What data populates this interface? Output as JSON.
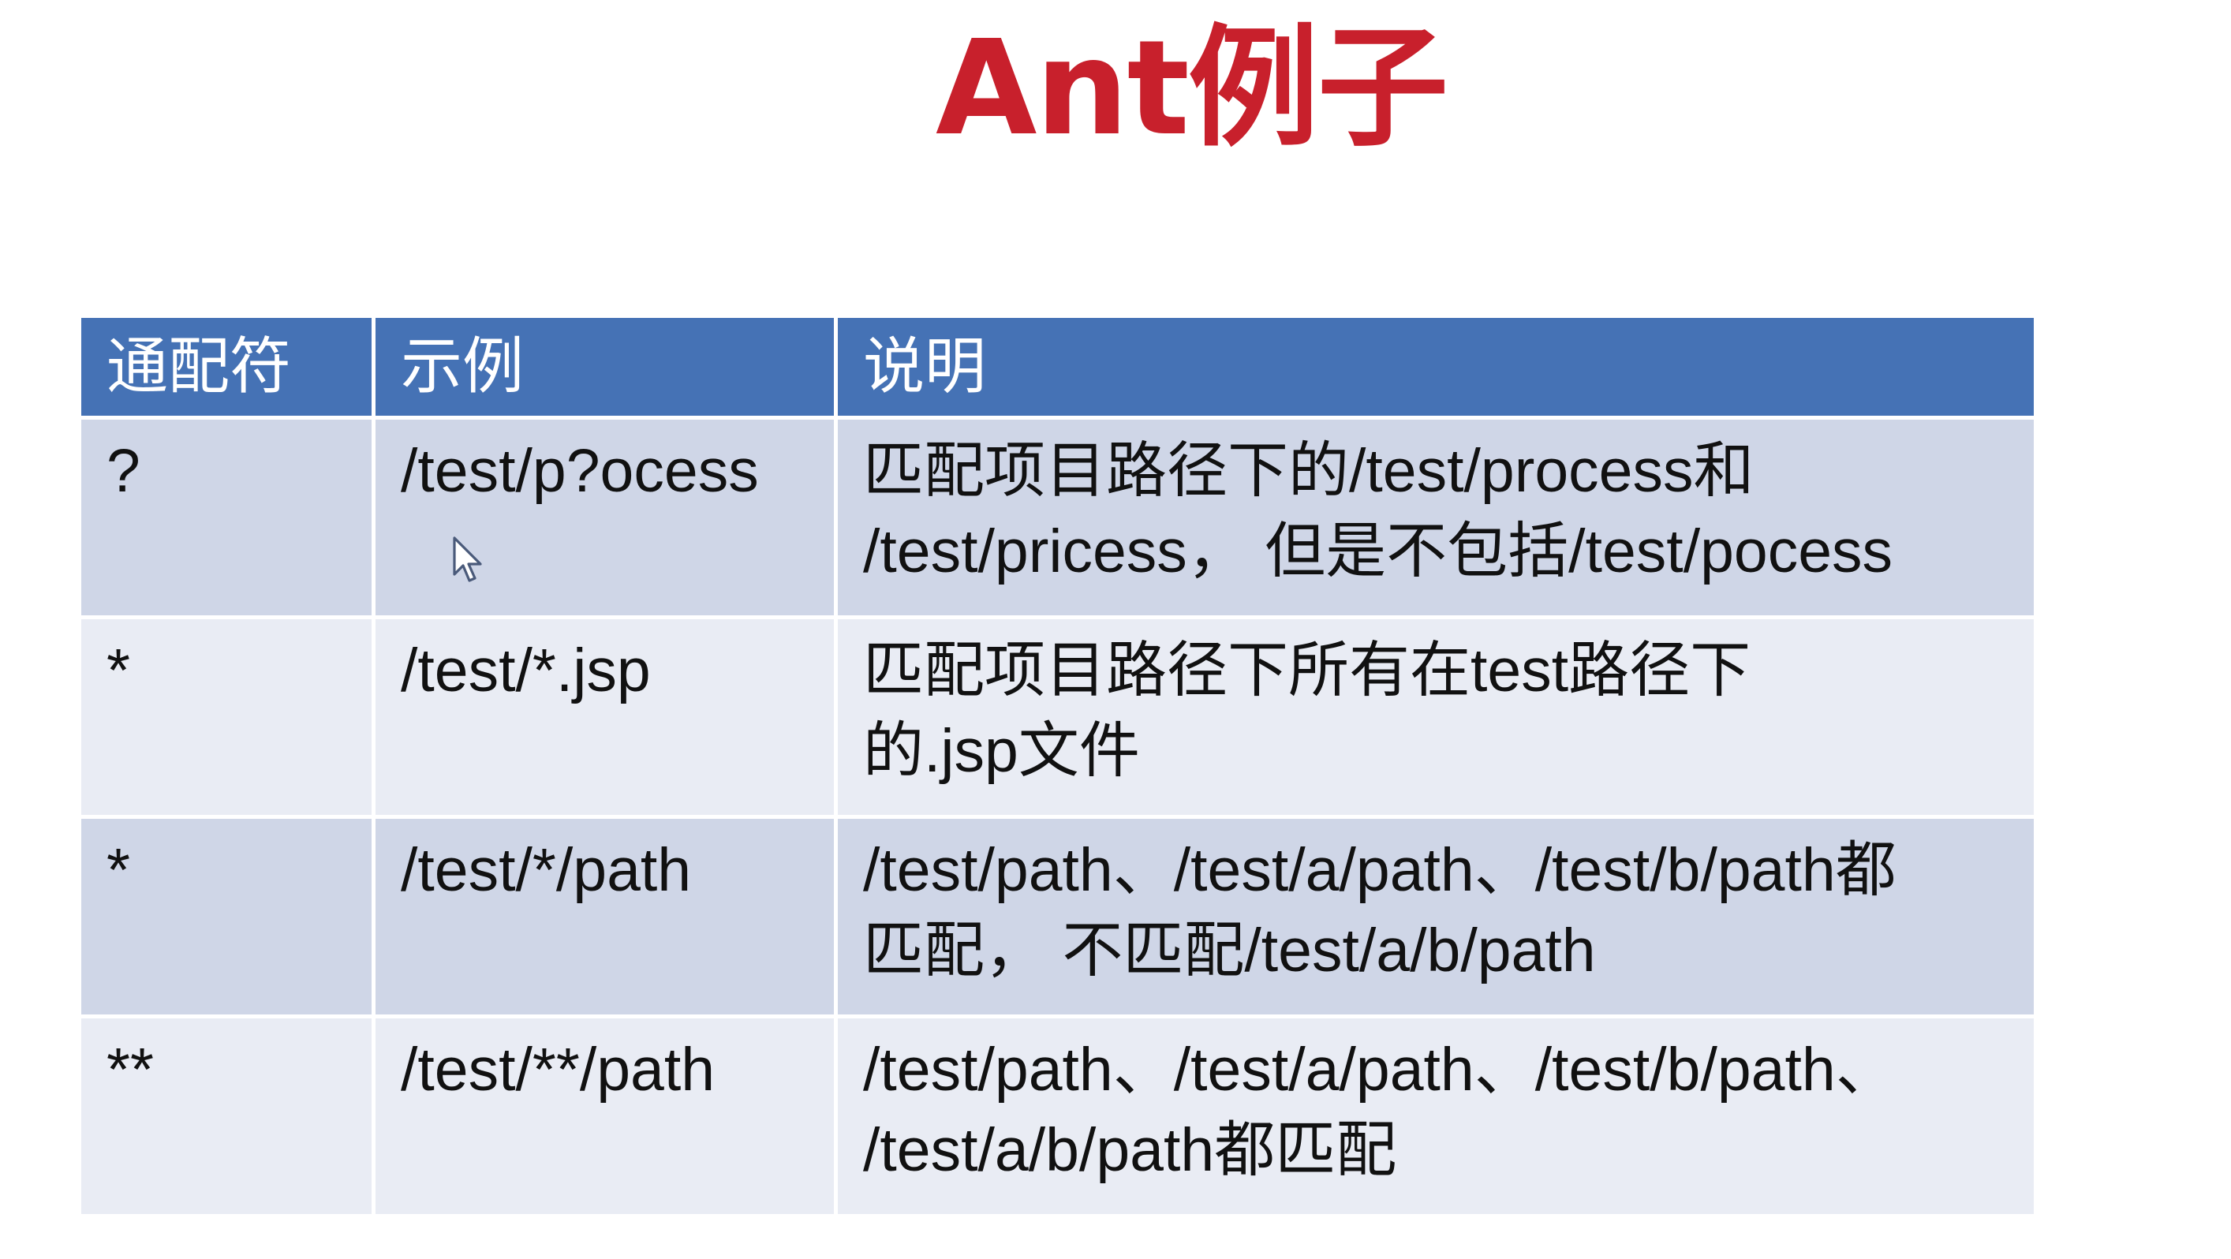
{
  "slide": {
    "title": "Ant例子"
  },
  "table": {
    "headers": [
      "通配符",
      "示例",
      "说明"
    ],
    "rows": [
      {
        "wildcard": "?",
        "example": "/test/p?ocess",
        "description": "匹配项目路径下的/test/process和\n/test/pricess，  但是不包括/test/pocess"
      },
      {
        "wildcard": "*",
        "example": "/test/*.jsp",
        "description": "匹配项目路径下所有在test路径下\n的.jsp文件"
      },
      {
        "wildcard": "*",
        "example": "/test/*/path",
        "description": "/test/path、/test/a/path、/test/b/path都\n匹配，  不匹配/test/a/b/path"
      },
      {
        "wildcard": "**",
        "example": "/test/**/path",
        "description": "/test/path、/test/a/path、/test/b/path、\n/test/a/b/path都匹配"
      }
    ]
  },
  "colors": {
    "title": "#c8202c",
    "header_background": "#4572b5",
    "row_band_dark": "#cfd6e7",
    "row_band_light": "#e9ecf4"
  },
  "icons": {
    "cursor": "mouse-pointer-arrow"
  }
}
